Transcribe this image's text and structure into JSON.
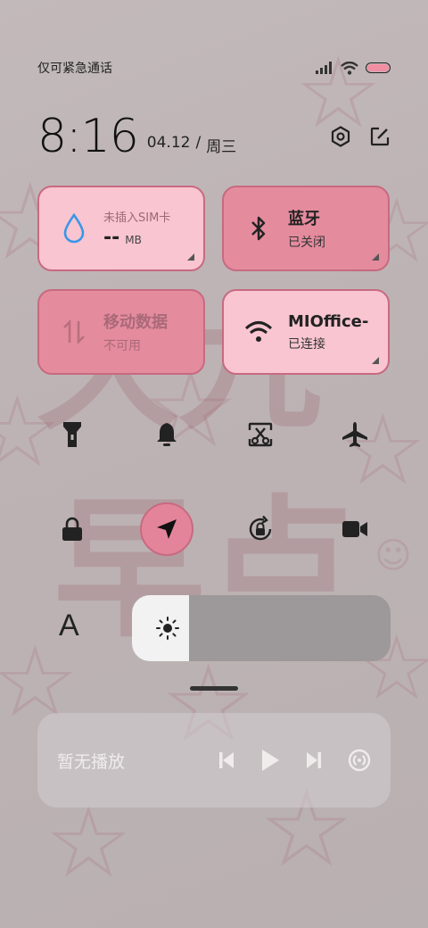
{
  "status_bar": {
    "carrier_text": "仅可紧急通话",
    "icons": [
      "signal-icon",
      "wifi-icon",
      "battery-icon"
    ],
    "battery_color": "#f08ea2"
  },
  "header": {
    "time": "8:16",
    "date": "04.12",
    "separator": "/",
    "weekday": "周三",
    "actions": [
      "settings-icon",
      "edit-icon"
    ]
  },
  "tiles": {
    "data_usage": {
      "label": "未插入SIM卡",
      "value": "--",
      "unit": "MB",
      "icon": "water-drop-icon"
    },
    "bluetooth": {
      "title": "蓝牙",
      "status": "已关闭",
      "icon": "bluetooth-icon"
    },
    "mobile_data": {
      "title": "移动数据",
      "status": "不可用",
      "icon": "data-transfer-icon"
    },
    "wifi": {
      "title": "MIOffice-",
      "status": "已连接",
      "icon": "wifi-icon"
    }
  },
  "toggles_row1": [
    "flashlight-icon",
    "bell-icon",
    "screenshot-icon",
    "airplane-icon"
  ],
  "toggles_row2": [
    "lock-icon",
    "location-icon",
    "rotation-lock-icon",
    "video-camera-icon"
  ],
  "brightness": {
    "level": 0.22,
    "font_label": "A",
    "icon": "sun-icon"
  },
  "media": {
    "title": "暂无播放",
    "controls": [
      "previous-icon",
      "play-icon",
      "next-icon",
      "cast-icon"
    ]
  },
  "colors": {
    "tile_light": "#f8c5d0",
    "tile_dark": "#e58b9e",
    "tile_border": "#c76a80",
    "active_toggle": "#e3849a"
  }
}
